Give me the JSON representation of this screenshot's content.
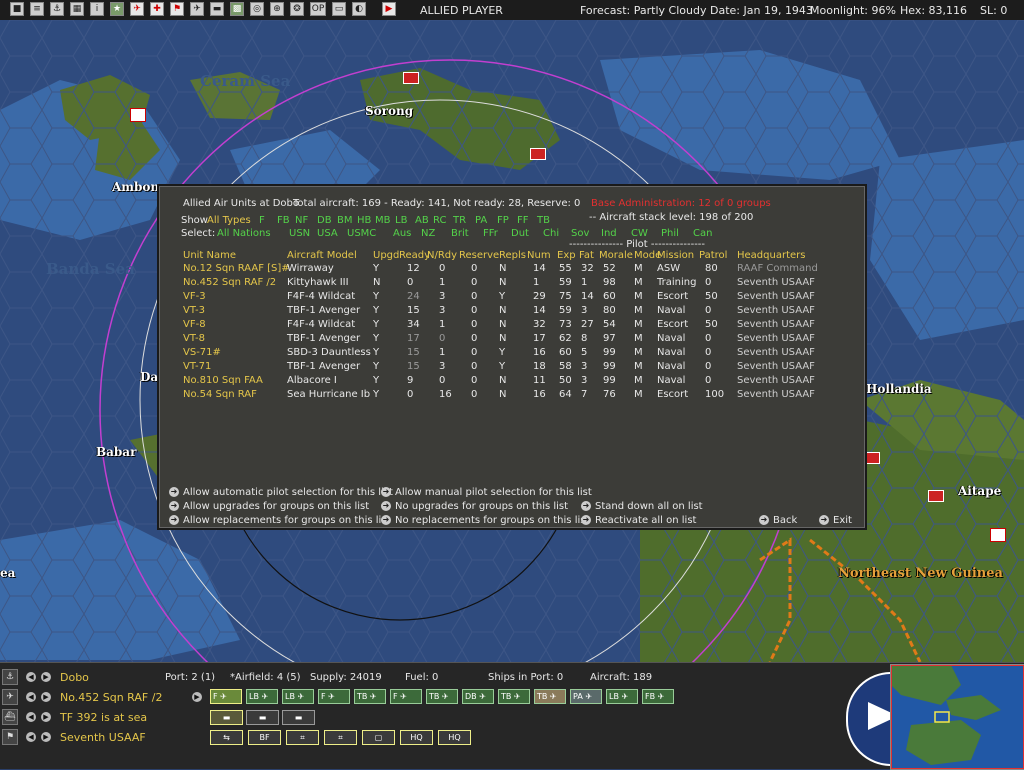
{
  "topbar": {
    "side": "ALLIED PLAYER",
    "forecast": "Forecast: Partly Cloudy",
    "date": "Date: Jan 19, 1943",
    "moonlight": "Moonlight: 96%",
    "hex": "Hex: 83,116",
    "sl": "SL: 0",
    "buttons": [
      "menu-icon",
      "report-icon",
      "ships-icon",
      "base-icon",
      "info-icon",
      "star-icon",
      "plane-icon",
      "ground-icon",
      "flag-icon",
      "air-icon",
      "sub-icon",
      "map-icon",
      "globe-icon",
      "search-icon",
      "op-icon",
      "image-icon",
      "toggle-icon",
      "end-turn-icon"
    ]
  },
  "map": {
    "places": [
      "Ceram Sea",
      "Sorong",
      "Ambon",
      "Banda Sea",
      "Babar",
      "Hollandia",
      "Aitape",
      "Northeast New Guinea",
      "Da",
      "ea"
    ]
  },
  "dialog": {
    "title": "Allied Air Units at Dobo",
    "total_aircraft": "Total aircraft: 169 - Ready: 141, Not ready: 28, Reserve: 0",
    "warning": "Base Administration: 12 of 0 groups",
    "stack_level": "-- Aircraft stack level: 198 of 200",
    "show_label": "Show",
    "show_types": [
      "All Types",
      "F",
      "FB",
      "NF",
      "DB",
      "BM",
      "HB",
      "MB",
      "LB",
      "AB",
      "RC",
      "TR",
      "PA",
      "FP",
      "FF",
      "TB"
    ],
    "select_label": "Select:",
    "select_nations": [
      "All Nations",
      "USN",
      "USA",
      "USMC",
      "Aus",
      "NZ",
      "Brit",
      "FFr",
      "Dut",
      "Chi",
      "Sov",
      "Ind",
      "CW",
      "Phil",
      "Can"
    ],
    "pilot_header": "--------------- Pilot ---------------",
    "columns": [
      "Unit Name",
      "Aircraft Model",
      "Upgd",
      "Ready",
      "N/Rdy",
      "Reserve",
      "Repls",
      "Num",
      "Exp",
      "Fat",
      "Morale",
      "Mode",
      "Mission",
      "Patrol",
      "Headquarters"
    ],
    "rows": [
      [
        "No.12 Sqn RAAF [S]#",
        "Wirraway",
        "Y",
        "12",
        "0",
        "0",
        "N",
        "14",
        "55",
        "32",
        "52",
        "M",
        "ASW",
        "80",
        "RAAF Command"
      ],
      [
        "No.452 Sqn RAF /2",
        "Kittyhawk III",
        "N",
        "0",
        "1",
        "0",
        "N",
        "1",
        "59",
        "1",
        "98",
        "M",
        "Training",
        "0",
        "Seventh USAAF"
      ],
      [
        "VF-3",
        "F4F-4 Wildcat",
        "Y",
        "24",
        "3",
        "0",
        "Y",
        "29",
        "75",
        "14",
        "60",
        "M",
        "Escort",
        "50",
        "Seventh USAAF"
      ],
      [
        "VT-3",
        "TBF-1 Avenger",
        "Y",
        "15",
        "3",
        "0",
        "N",
        "14",
        "59",
        "3",
        "80",
        "M",
        "Naval",
        "0",
        "Seventh USAAF"
      ],
      [
        "VF-8",
        "F4F-4 Wildcat",
        "Y",
        "34",
        "1",
        "0",
        "N",
        "32",
        "73",
        "27",
        "54",
        "M",
        "Escort",
        "50",
        "Seventh USAAF"
      ],
      [
        "VT-8",
        "TBF-1 Avenger",
        "Y",
        "17",
        "0",
        "0",
        "N",
        "17",
        "62",
        "8",
        "97",
        "M",
        "Naval",
        "0",
        "Seventh USAAF"
      ],
      [
        "VS-71#",
        "SBD-3 Dauntless",
        "Y",
        "15",
        "1",
        "0",
        "Y",
        "16",
        "60",
        "5",
        "99",
        "M",
        "Naval",
        "0",
        "Seventh USAAF"
      ],
      [
        "VT-71",
        "TBF-1 Avenger",
        "Y",
        "15",
        "3",
        "0",
        "Y",
        "18",
        "58",
        "3",
        "99",
        "M",
        "Naval",
        "0",
        "Seventh USAAF"
      ],
      [
        "No.810 Sqn FAA",
        "Albacore I",
        "Y",
        "9",
        "0",
        "0",
        "N",
        "11",
        "50",
        "3",
        "99",
        "M",
        "Naval",
        "0",
        "Seventh USAAF"
      ],
      [
        "No.54 Sqn RAF",
        "Sea Hurricane Ib",
        "Y",
        "0",
        "16",
        "0",
        "N",
        "16",
        "64",
        "7",
        "76",
        "M",
        "Escort",
        "100",
        "Seventh USAAF"
      ]
    ],
    "options": {
      "auto_pilot": "Allow automatic pilot selection for this list",
      "manual_pilot": "Allow manual pilot selection for this list",
      "allow_upgrades": "Allow upgrades for groups on this list",
      "no_upgrades": "No upgrades for groups on this list",
      "stand_down": "Stand down all on list",
      "allow_repl": "Allow replacements for groups on this list",
      "no_repl": "No replacements for groups on this list",
      "reactivate": "Reactivate all on list",
      "back": "Back",
      "exit": "Exit"
    }
  },
  "bottom": {
    "base": "Dobo",
    "port": "Port: 2 (1)",
    "airfield": "*Airfield: 4 (5)",
    "supply": "Supply: 24019",
    "fuel": "Fuel: 0",
    "ships": "Ships in Port: 0",
    "aircraft": "Aircraft: 189",
    "unit": "No.452 Sqn RAF /2",
    "tf": "TF 392 is at sea",
    "hq": "Seventh USAAF",
    "plane_buttons": [
      "F",
      "LB",
      "LB",
      "F",
      "TB",
      "F",
      "TB",
      "DB",
      "TB",
      "TB",
      "PA",
      "LB",
      "FB"
    ],
    "action_buttons": [
      "BF",
      "HQ",
      "HQ"
    ]
  }
}
